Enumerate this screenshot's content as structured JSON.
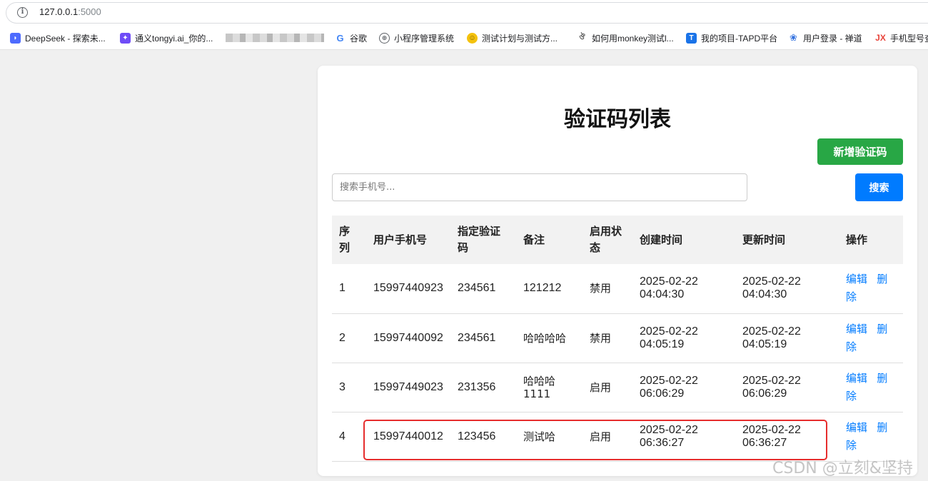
{
  "browser": {
    "url_host": "127.0.0.1",
    "url_port": ":5000",
    "bookmarks": [
      {
        "label": "DeepSeek - 探索未...",
        "icon": "deepseek-icon",
        "color": "#4d6bfe"
      },
      {
        "label": "通义tongyi.ai_你的...",
        "icon": "tongyi-icon",
        "color": "#6f4cf7"
      },
      {
        "label": "谷歌",
        "icon": "google-icon",
        "color": "#4285f4"
      },
      {
        "label": "小程序管理系统",
        "icon": "globe-icon",
        "color": "#5f6368"
      },
      {
        "label": "测试计划与测试方...",
        "icon": "smiley-icon",
        "color": "#f4c20d"
      },
      {
        "label": "如何用monkey测试l...",
        "icon": "lark-icon",
        "color": "#444444"
      },
      {
        "label": "我的项目-TAPD平台",
        "icon": "tapd-icon",
        "color": "#1a73e8"
      },
      {
        "label": "用户登录 - 禅道",
        "icon": "zentao-icon",
        "color": "#2f6fde"
      },
      {
        "label": "手机型号查",
        "icon": "jx-icon",
        "color": "#e8453c"
      }
    ]
  },
  "page": {
    "title": "验证码列表",
    "add_button": "新增验证码",
    "search_placeholder": "搜索手机号...",
    "search_button": "搜索"
  },
  "table": {
    "headers": [
      "序列",
      "用户手机号",
      "指定验证码",
      "备注",
      "启用状态",
      "创建时间",
      "更新时间",
      "操作"
    ],
    "rows": [
      {
        "id": "1",
        "phone": "15997440923",
        "code": "234561",
        "note": "121212",
        "status": "禁用",
        "created": "2025-02-22 04:04:30",
        "updated": "2025-02-22 04:04:30"
      },
      {
        "id": "2",
        "phone": "15997440092",
        "code": "234561",
        "note": "哈哈哈哈",
        "status": "禁用",
        "created": "2025-02-22 04:05:19",
        "updated": "2025-02-22 04:05:19"
      },
      {
        "id": "3",
        "phone": "15997449023",
        "code": "231356",
        "note": "哈哈哈 1111",
        "status": "启用",
        "created": "2025-02-22 06:06:29",
        "updated": "2025-02-22 06:06:29"
      },
      {
        "id": "4",
        "phone": "15997440012",
        "code": "123456",
        "note": "测试哈",
        "status": "启用",
        "created": "2025-02-22 06:36:27",
        "updated": "2025-02-22 06:36:27"
      }
    ],
    "edit_label": "编辑",
    "delete_label": "删除"
  },
  "watermark": "CSDN @立刻&坚持",
  "colors": {
    "add_button": "#28a745",
    "search_button": "#007bff",
    "link": "#007bff",
    "highlight": "#e62d2d"
  }
}
